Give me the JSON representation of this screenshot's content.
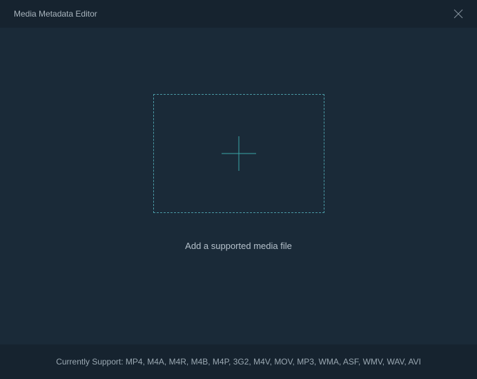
{
  "titlebar": {
    "title": "Media Metadata Editor"
  },
  "main": {
    "dropzone_label": "Add a supported media file"
  },
  "footer": {
    "supported_text": "Currently Support: MP4, M4A, M4R, M4B, M4P, 3G2, M4V, MOV, MP3, WMA, ASF, WMV, WAV, AVI"
  }
}
